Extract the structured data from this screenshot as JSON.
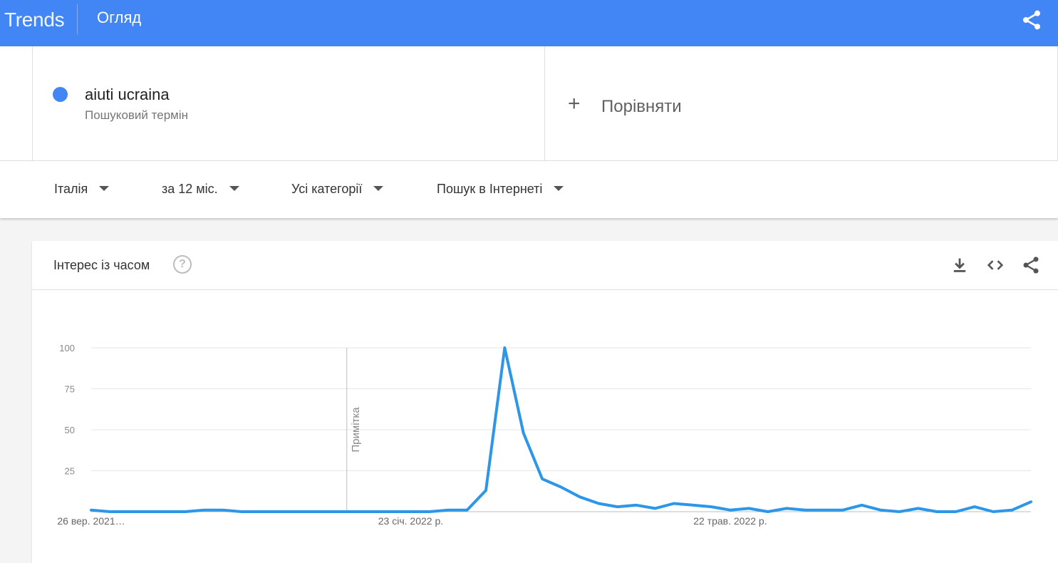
{
  "app": {
    "brand": "Trends",
    "page_title": "Огляд"
  },
  "search_term": {
    "name": "aiuti ucraina",
    "type": "Пошуковий термін",
    "color": "#4285f4"
  },
  "compare": {
    "plus": "+",
    "label": "Порівняти"
  },
  "filters": [
    {
      "label": "Італія"
    },
    {
      "label": "за 12 міс."
    },
    {
      "label": "Усі категорії"
    },
    {
      "label": "Пошук в Інтернеті"
    }
  ],
  "card": {
    "title": "Інтерес із часом",
    "help": "?"
  },
  "icons": {
    "top_share": "share-icon",
    "download": "download-icon",
    "embed": "embed-code-icon",
    "share": "share-icon",
    "help": "help-icon"
  },
  "colors": {
    "header": "#4285f4",
    "series": "#2d96e6"
  },
  "chart_data": {
    "type": "line",
    "title": "Інтерес із часом",
    "xlabel": "",
    "ylabel": "",
    "ylim": [
      0,
      100
    ],
    "y_ticks": [
      "100",
      "75",
      "50",
      "25"
    ],
    "x_tick_labels": [
      "26 вер. 2021…",
      "23 січ. 2022 р.",
      "22 трав. 2022 р."
    ],
    "annotation": {
      "label": "Примітка",
      "at": "30 груд. 2021"
    },
    "grid": true,
    "series": [
      {
        "name": "aiuti ucraina",
        "x": [
          "26 вер. 2021",
          "3 жовт. 2021",
          "10 жовт. 2021",
          "17 жовт. 2021",
          "24 жовт. 2021",
          "31 жовт. 2021",
          "7 лист. 2021",
          "14 лист. 2021",
          "21 лист. 2021",
          "28 лист. 2021",
          "5 груд. 2021",
          "12 груд. 2021",
          "19 груд. 2021",
          "26 груд. 2021",
          "2 січ. 2022",
          "9 січ. 2022",
          "16 січ. 2022",
          "23 січ. 2022",
          "30 січ. 2022",
          "6 лют. 2022",
          "13 лют. 2022",
          "20 лют. 2022",
          "27 лют. 2022",
          "6 бер. 2022",
          "13 бер. 2022",
          "20 бер. 2022",
          "27 бер. 2022",
          "3 квіт. 2022",
          "10 квіт. 2022",
          "17 квіт. 2022",
          "24 квіт. 2022",
          "1 трав. 2022",
          "8 трав. 2022",
          "15 трав. 2022",
          "22 трав. 2022",
          "29 трав. 2022",
          "5 черв. 2022",
          "12 черв. 2022",
          "19 черв. 2022",
          "26 черв. 2022",
          "3 лип. 2022",
          "10 лип. 2022",
          "17 лип. 2022",
          "24 лип. 2022",
          "31 лип. 2022",
          "7 серп. 2022",
          "14 серп. 2022",
          "21 серп. 2022",
          "28 серп. 2022",
          "4 вер. 2022",
          "11 вер. 2022"
        ],
        "values": [
          1,
          0,
          0,
          0,
          0,
          0,
          1,
          1,
          0,
          0,
          0,
          0,
          0,
          0,
          0,
          0,
          0,
          0,
          0,
          1,
          1,
          13,
          100,
          48,
          20,
          15,
          9,
          5,
          3,
          4,
          2,
          5,
          4,
          3,
          1,
          2,
          0,
          2,
          1,
          1,
          1,
          4,
          1,
          0,
          2,
          0,
          0,
          3,
          0,
          1,
          6
        ]
      }
    ]
  }
}
